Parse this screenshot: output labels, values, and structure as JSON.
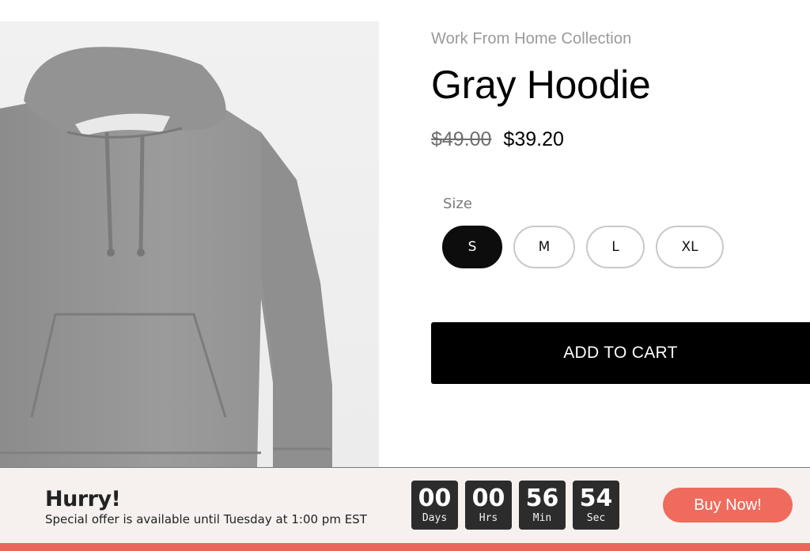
{
  "product": {
    "collection": "Work From Home Collection",
    "title": "Gray Hoodie",
    "old_price": "$49.00",
    "new_price": "$39.20",
    "image_icon": "gray-hoodie-photo"
  },
  "size_selector": {
    "label": "Size",
    "options": [
      "S",
      "M",
      "L",
      "XL"
    ],
    "selected": "S"
  },
  "cart": {
    "add_label": "ADD TO CART"
  },
  "promo": {
    "headline": "Hurry!",
    "message": "Special offer is available until Tuesday at 1:00 pm EST",
    "countdown": [
      {
        "value": "00",
        "unit": "Days"
      },
      {
        "value": "00",
        "unit": "Hrs"
      },
      {
        "value": "56",
        "unit": "Min"
      },
      {
        "value": "54",
        "unit": "Sec"
      }
    ],
    "buy_label": "Buy Now!"
  },
  "colors": {
    "accent": "#ee6b5d",
    "primary": "#000000",
    "promo_background": "#f6f1ef",
    "countdown_box": "#2c2c2c"
  }
}
